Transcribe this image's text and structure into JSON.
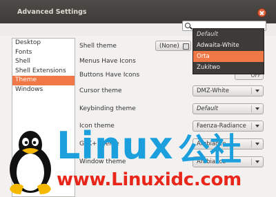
{
  "window": {
    "title": "Advanced Settings"
  },
  "search": {
    "placeholder": ""
  },
  "sidebar": {
    "items": [
      {
        "label": "Desktop",
        "selected": false
      },
      {
        "label": "Fonts",
        "selected": false
      },
      {
        "label": "Shell",
        "selected": false
      },
      {
        "label": "Shell Extensions",
        "selected": false
      },
      {
        "label": "Theme",
        "selected": true
      },
      {
        "label": "Windows",
        "selected": false
      }
    ]
  },
  "settings": {
    "shell_theme": {
      "label": "Shell theme",
      "value": "(None)"
    },
    "menus_have_icons": {
      "label": "Menus Have Icons"
    },
    "buttons_have_icons": {
      "label": "Buttons Have Icons",
      "value": "OFF"
    },
    "cursor_theme": {
      "label": "Cursor theme",
      "value": "DMZ-White"
    },
    "keybinding_theme": {
      "label": "Keybinding theme",
      "value": "Default"
    },
    "icon_theme": {
      "label": "Icon theme",
      "value": "Faenza-Radiance"
    },
    "gtk_theme": {
      "label": "GTK+ theme",
      "value": "Ambiance"
    },
    "window_theme": {
      "label": "Window theme",
      "value": "Ambiance"
    }
  },
  "dropdown": {
    "options": [
      {
        "label": "Default",
        "italic": true,
        "highlighted": false
      },
      {
        "label": "Adwaita-White",
        "italic": false,
        "highlighted": false
      },
      {
        "label": "Orta",
        "italic": false,
        "highlighted": true
      },
      {
        "label": "Zukitwo",
        "italic": false,
        "highlighted": false
      }
    ]
  },
  "watermark": {
    "word": "Linux",
    "cjk": "公社",
    "url": "www.Linuxidc.com"
  },
  "colors": {
    "accent": "#f07746",
    "titlebar": "#3c3b37",
    "watermark_blue": "#1b9fdd",
    "watermark_red": "#e8261a"
  }
}
